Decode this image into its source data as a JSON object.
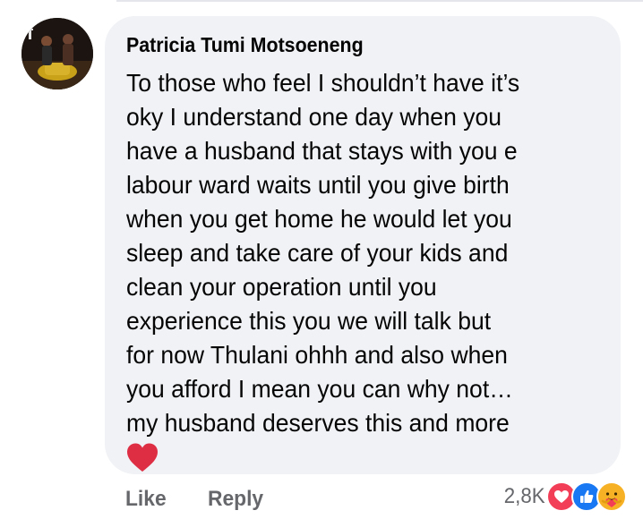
{
  "comment": {
    "author": "Patricia Tumi Motsoeneng",
    "lines": [
      "To those who feel I shouldn’t have it’s",
      "oky I understand one day when you",
      "have a husband that stays with you e",
      "labour ward waits until you give birth",
      "when you get home he would let you",
      "sleep and take care of your kids and",
      "clean your operation until you",
      "experience this you we will talk but",
      "for now Thulani ohhh and also when",
      "you afford I mean you can why not…",
      "my husband deserves this and more"
    ],
    "emoji": "heart-emoji"
  },
  "actions": {
    "like_label": "Like",
    "reply_label": "Reply"
  },
  "reactions": {
    "count": "2,8K",
    "icons": [
      "love-reaction-icon",
      "like-reaction-icon",
      "care-reaction-icon"
    ]
  },
  "colors": {
    "bubble": "#f0f2f5",
    "secondary_text": "#65676b",
    "love": "#f33e58",
    "like": "#1877f2",
    "care": "#f7b125"
  }
}
